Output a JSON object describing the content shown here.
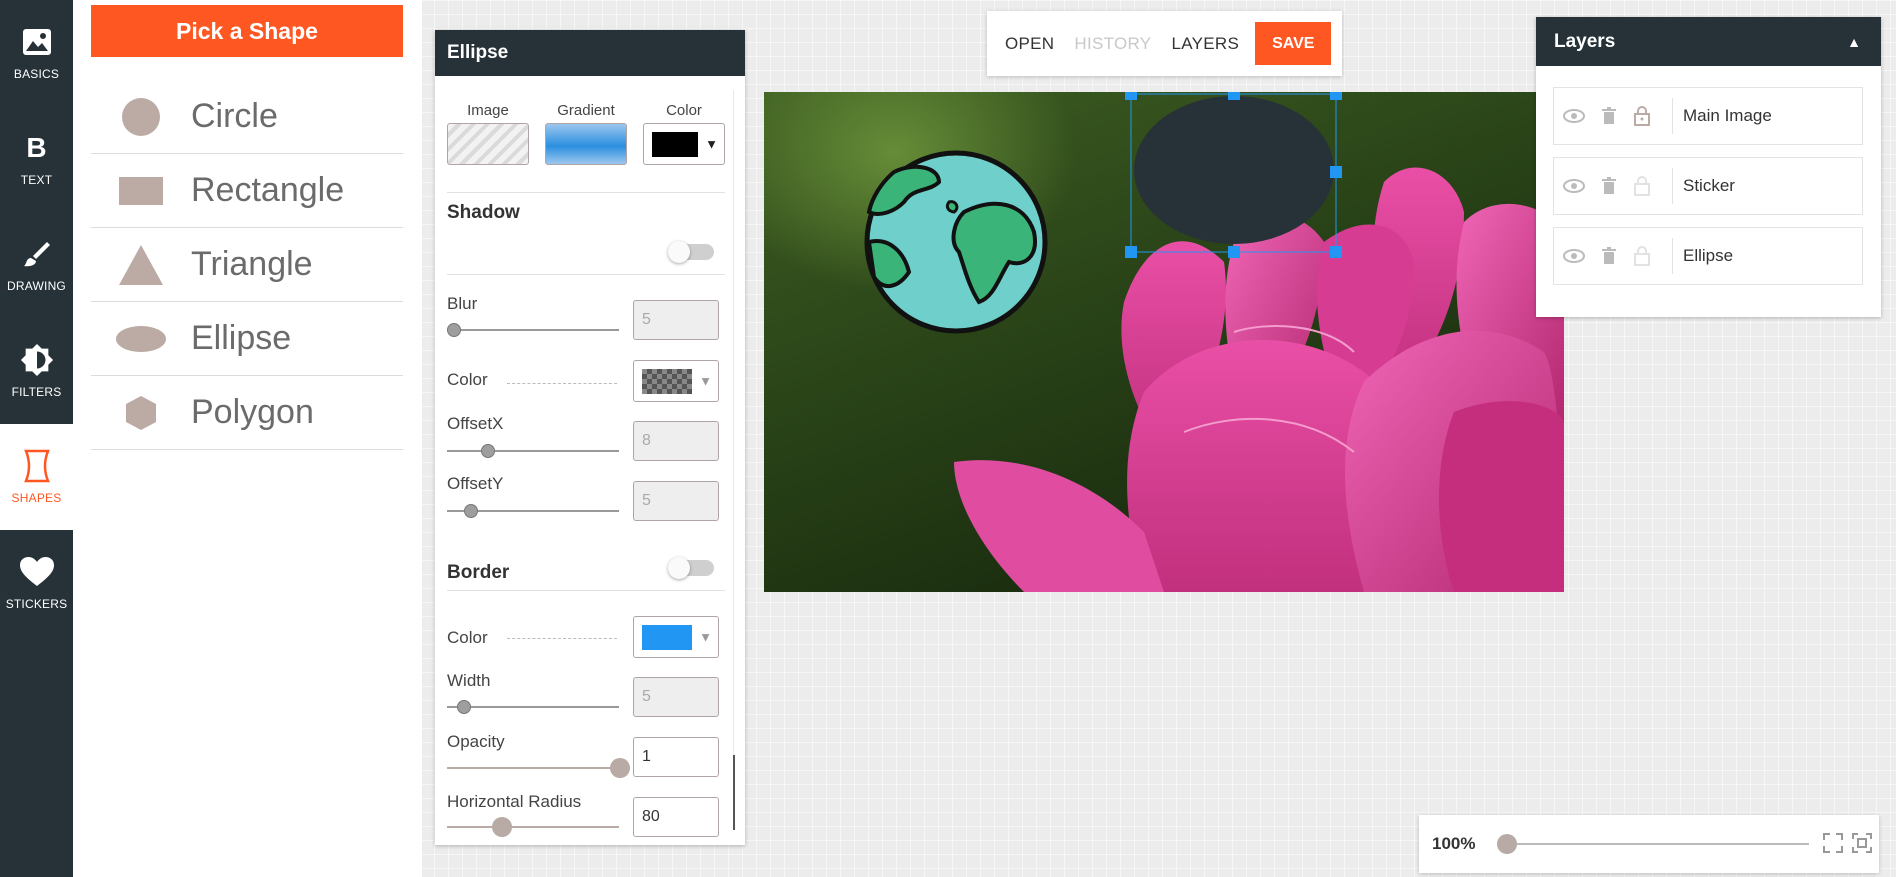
{
  "nav": {
    "items": [
      {
        "label": "BASICS",
        "icon": "image-icon"
      },
      {
        "label": "TEXT",
        "icon": "bold-b-icon"
      },
      {
        "label": "DRAWING",
        "icon": "brush-icon"
      },
      {
        "label": "FILTERS",
        "icon": "brightness-icon"
      },
      {
        "label": "SHAPES",
        "icon": "shape-icon",
        "active": true
      },
      {
        "label": "STICKERS",
        "icon": "heart-icon"
      }
    ]
  },
  "picker": {
    "button_label": "Pick a Shape",
    "shapes": [
      "Circle",
      "Rectangle",
      "Triangle",
      "Ellipse",
      "Polygon"
    ]
  },
  "panel": {
    "title": "Ellipse",
    "fill": {
      "image_label": "Image",
      "gradient_label": "Gradient",
      "color_label": "Color",
      "color_value": "#000000"
    },
    "shadow": {
      "title": "Shadow",
      "blur_label": "Blur",
      "blur_value": "5",
      "color_label": "Color",
      "offset_x_label": "OffsetX",
      "offset_x_value": "8",
      "offset_y_label": "OffsetY",
      "offset_y_value": "5"
    },
    "border": {
      "title": "Border",
      "color_label": "Color",
      "color_value": "#2196f3",
      "width_label": "Width",
      "width_value": "5"
    },
    "opacity_label": "Opacity",
    "opacity_value": "1",
    "hradius_label": "Horizontal Radius",
    "hradius_value": "80"
  },
  "toolbar": {
    "open": "OPEN",
    "history": "HISTORY",
    "layers": "LAYERS",
    "save": "SAVE"
  },
  "layers": {
    "title": "Layers",
    "items": [
      "Main Image",
      "Sticker",
      "Ellipse"
    ]
  },
  "zoom": {
    "value": "100%",
    "level": 0
  }
}
